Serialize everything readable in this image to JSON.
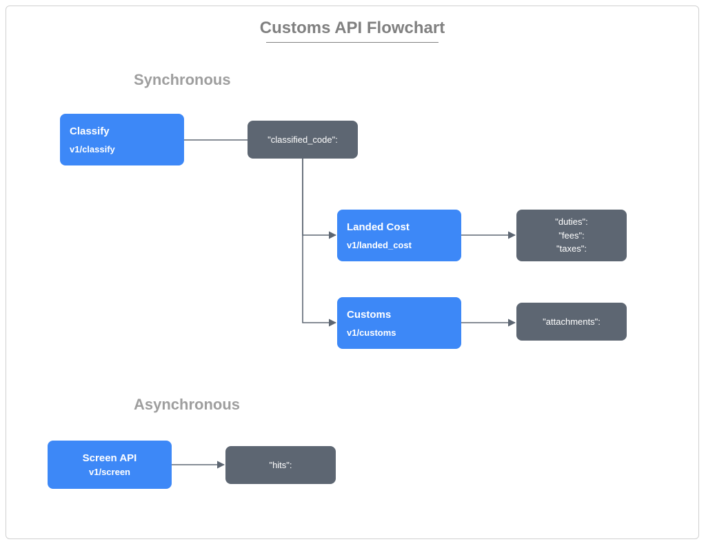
{
  "title": "Customs API Flowchart",
  "sections": {
    "sync": "Synchronous",
    "async": "Asynchronous"
  },
  "nodes": {
    "classify": {
      "title": "Classify",
      "endpoint": "v1/classify"
    },
    "classified_code": {
      "text": "\"classified_code\":"
    },
    "landed_cost": {
      "title": "Landed Cost",
      "endpoint": "v1/landed_cost"
    },
    "landed_cost_out": {
      "l1": "\"duties\":",
      "l2": "\"fees\":",
      "l3": "\"taxes\":"
    },
    "customs": {
      "title": "Customs",
      "endpoint": "v1/customs"
    },
    "customs_out": {
      "text": "\"attachments\":"
    },
    "screen": {
      "title": "Screen API",
      "endpoint": "v1/screen"
    },
    "screen_out": {
      "text": "\"hits\":"
    }
  },
  "colors": {
    "blue": "#3d88f7",
    "gray": "#5d6672",
    "line": "#5d6672",
    "label": "#9e9e9e"
  }
}
